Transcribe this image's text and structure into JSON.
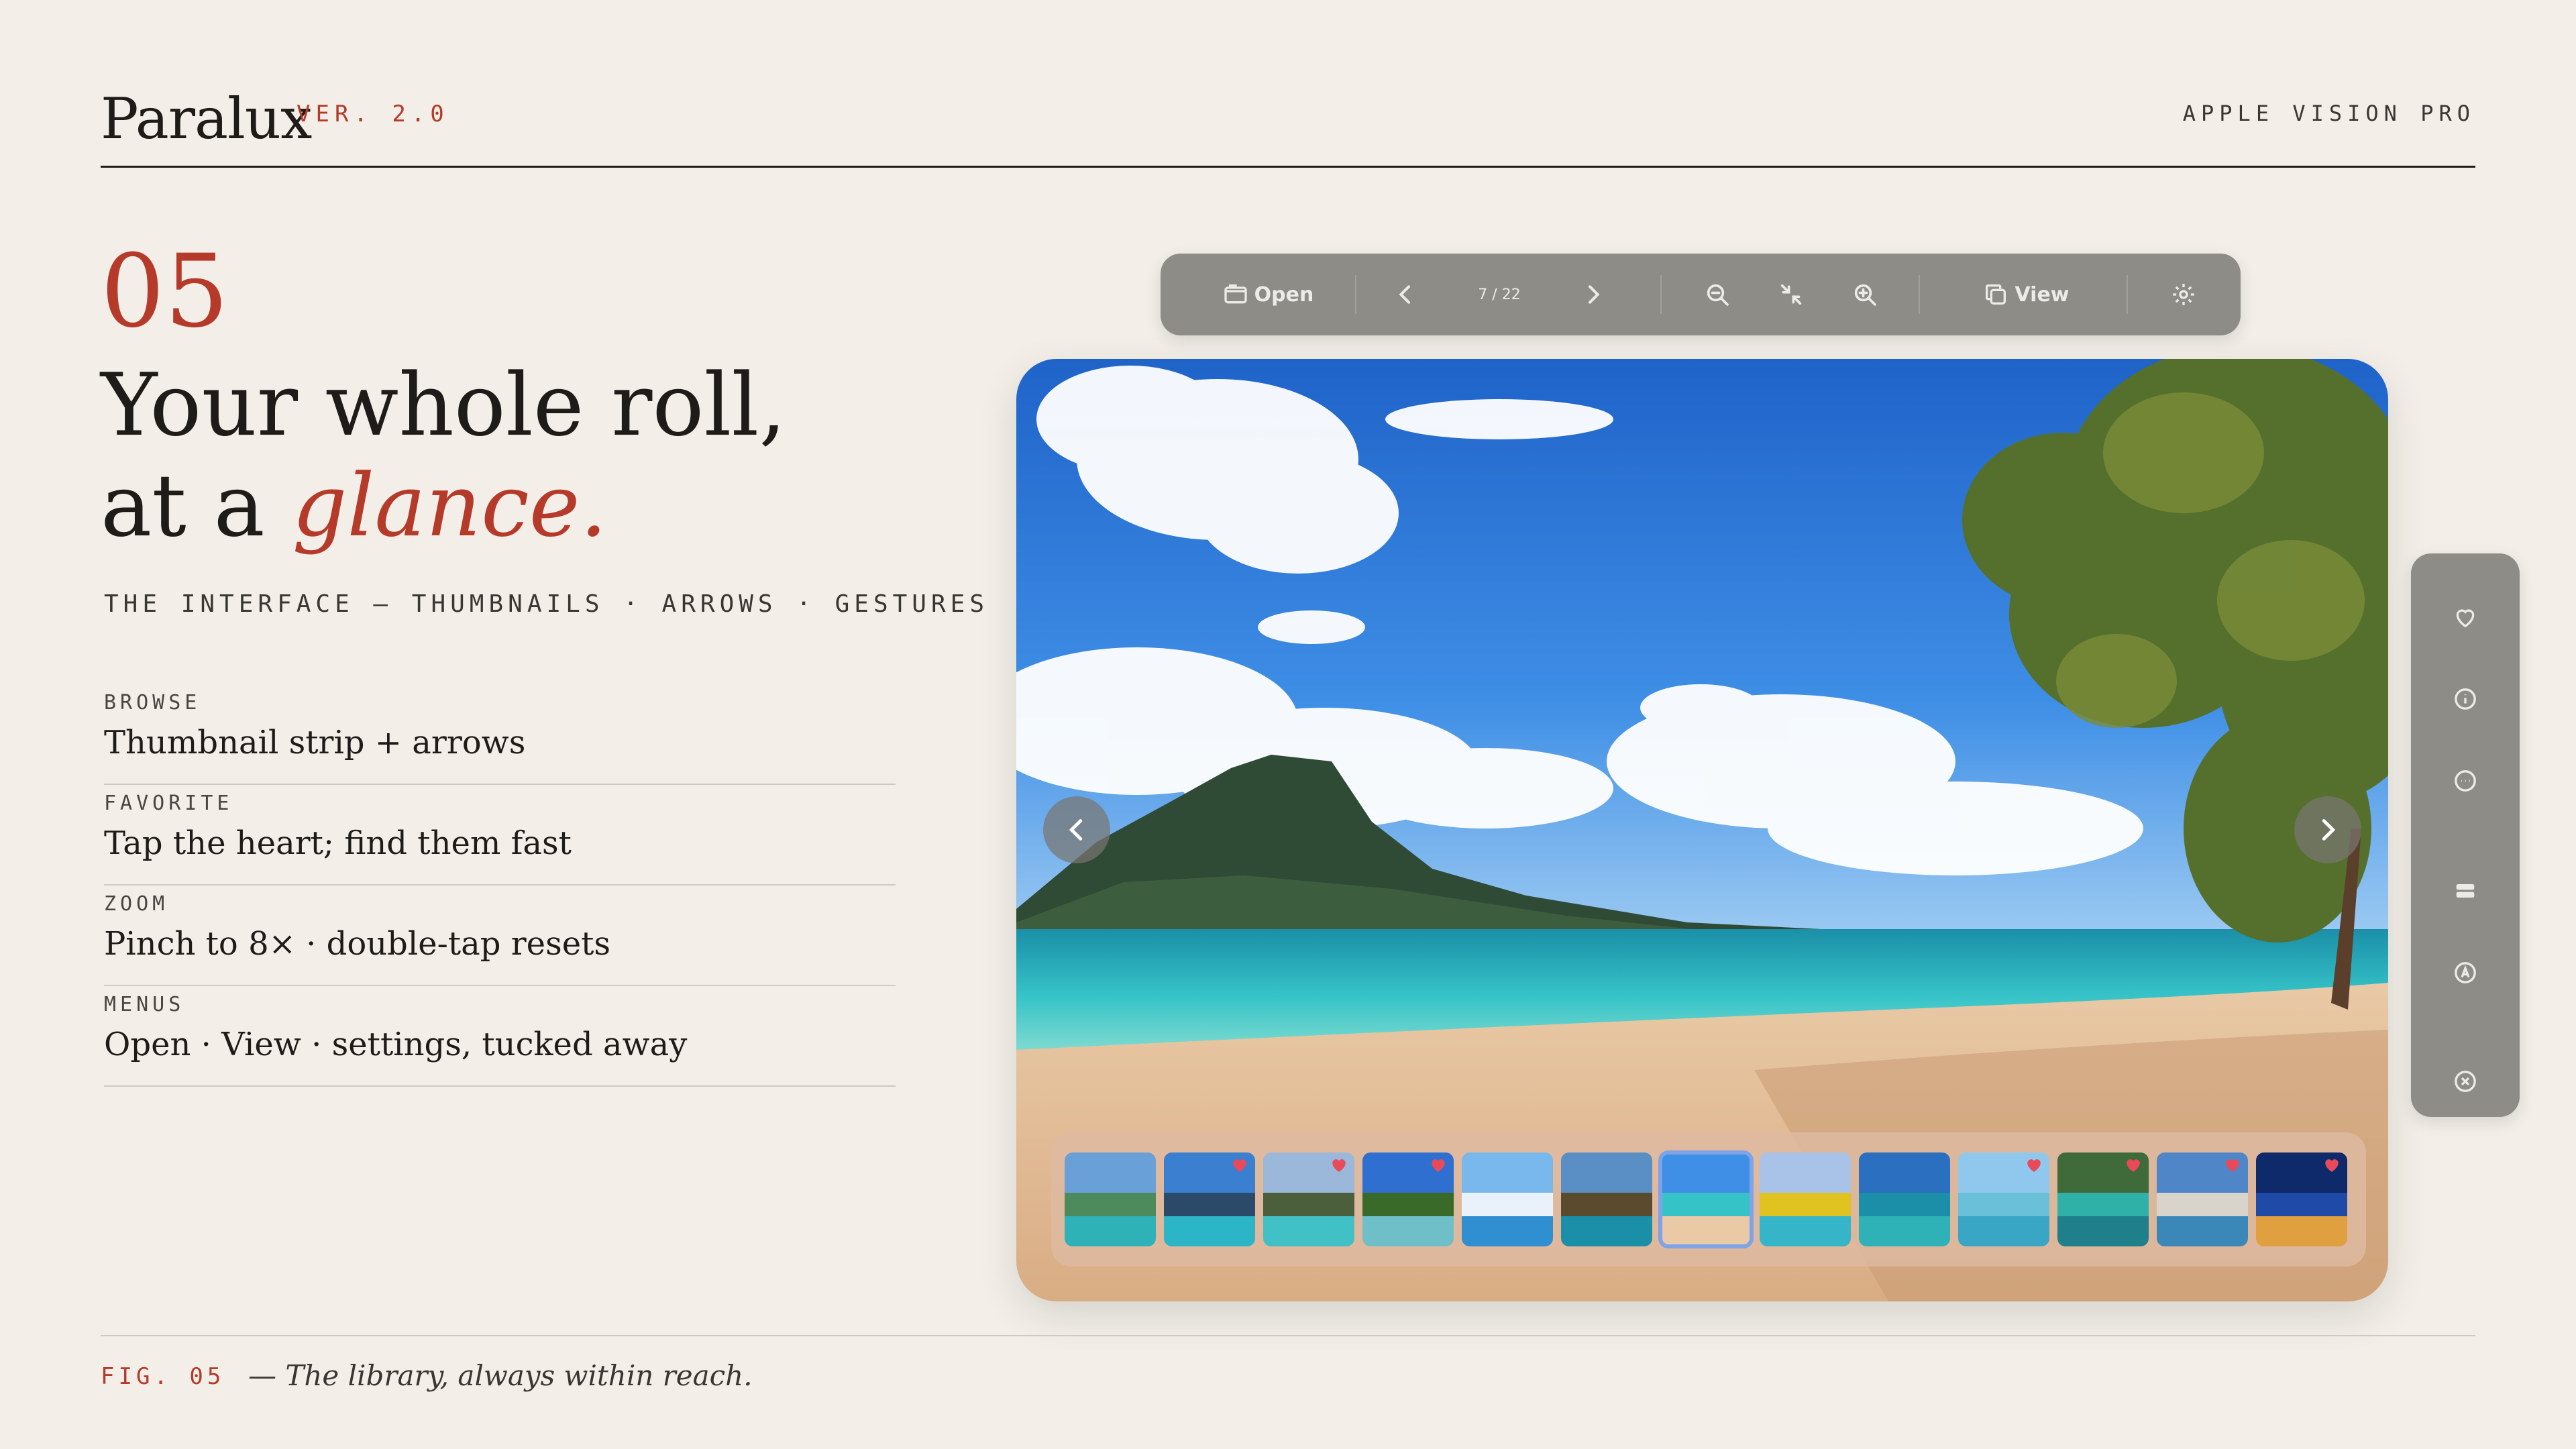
{
  "header": {
    "brand": "Paralux",
    "version": "VER. 2.0",
    "platform": "APPLE VISION PRO"
  },
  "intro": {
    "number": "05",
    "headline_line1": "Your whole roll,",
    "headline_line2_prefix": "at a ",
    "headline_line2_accent": "glance.",
    "subtitle": "THE INTERFACE — THUMBNAILS · ARROWS · GESTURES"
  },
  "features": [
    {
      "label": "BROWSE",
      "text": "Thumbnail strip + arrows"
    },
    {
      "label": "FAVORITE",
      "text": "Tap the heart; find them fast"
    },
    {
      "label": "ZOOM",
      "text": "Pinch to 8× · double-tap resets"
    },
    {
      "label": "MENUS",
      "text": "Open · View · settings, tucked away"
    }
  ],
  "toolbar": {
    "open_label": "Open",
    "counter": "7 / 22",
    "view_label": "View",
    "icons": [
      "folder-icon",
      "chevron-left-icon",
      "chevron-right-icon",
      "zoom-out-icon",
      "fit-icon",
      "zoom-in-icon",
      "copy-icon",
      "gear-icon"
    ]
  },
  "side_rail": {
    "icons": [
      "heart-icon",
      "info-icon",
      "more-icon",
      "panel-icon",
      "text-icon",
      "close-icon"
    ]
  },
  "thumbnails": {
    "count": 13,
    "selected_index": 6,
    "favorited_indices": [
      1,
      2,
      3,
      9,
      10,
      11,
      12
    ]
  },
  "colors": {
    "background": "#f3efe8",
    "accent": "#b63a2a",
    "panel": "#8e8c86",
    "selection": "#7ea3e8"
  },
  "footer": {
    "fig_label": "FIG. 05",
    "caption": "— The library, always within reach."
  }
}
